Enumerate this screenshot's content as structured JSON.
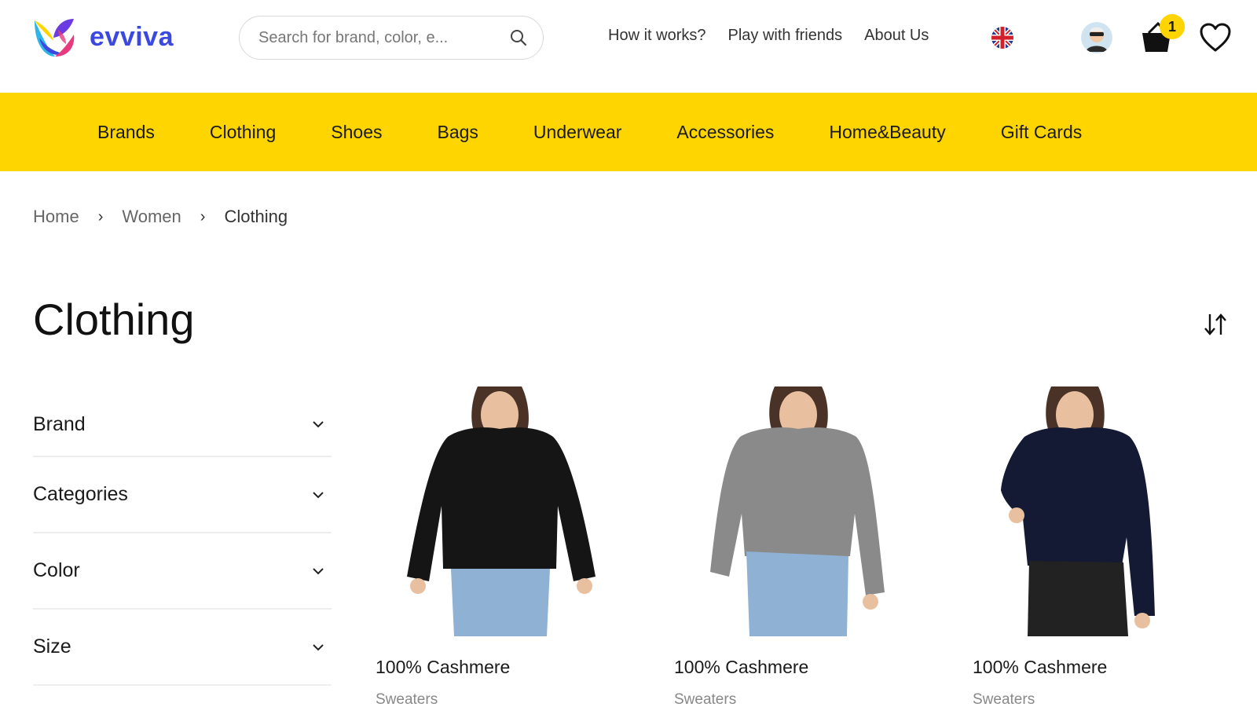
{
  "brand": {
    "name": "evviva",
    "color": "#3b49e0"
  },
  "search": {
    "placeholder": "Search for brand, color, e..."
  },
  "topnav": [
    "How it works?",
    "Play with friends",
    "About Us"
  ],
  "cart": {
    "count": "1"
  },
  "categories": [
    "Brands",
    "Clothing",
    "Shoes",
    "Bags",
    "Underwear",
    "Accessories",
    "Home&Beauty",
    "Gift Cards"
  ],
  "breadcrumb": [
    "Home",
    "Women",
    "Clothing"
  ],
  "page": {
    "title": "Clothing"
  },
  "filters": [
    "Brand",
    "Categories",
    "Color",
    "Size"
  ],
  "products": [
    {
      "name": "100% Cashmere",
      "category": "Sweaters",
      "color": "#151515"
    },
    {
      "name": "100% Cashmere",
      "category": "Sweaters",
      "color": "#8a8a8a"
    },
    {
      "name": "100% Cashmere",
      "category": "Sweaters",
      "color": "#141a33"
    }
  ],
  "colors": {
    "accent": "#ffd500",
    "badge": "#ffd400"
  }
}
